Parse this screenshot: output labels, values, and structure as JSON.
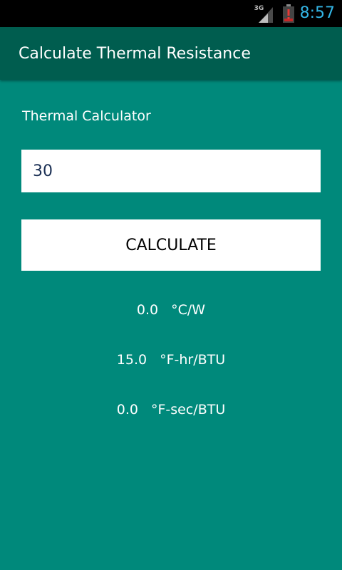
{
  "status_bar": {
    "network_label": "3G",
    "network_icon": "signal-icon",
    "battery_icon": "battery-alert-icon",
    "time": "8:57",
    "time_color": "#33b5e5"
  },
  "app_bar": {
    "title": "Calculate Thermal Resistance",
    "color": "#005d4f"
  },
  "main": {
    "background": "#00897b",
    "subtitle": "Thermal Calculator",
    "input_value": "30",
    "calculate_label": "CALCULATE",
    "results": [
      {
        "value": "0.0",
        "unit": "°C/W"
      },
      {
        "value": "15.0",
        "unit": "°F-hr/BTU"
      },
      {
        "value": "0.0",
        "unit": "°F-sec/BTU"
      }
    ]
  }
}
